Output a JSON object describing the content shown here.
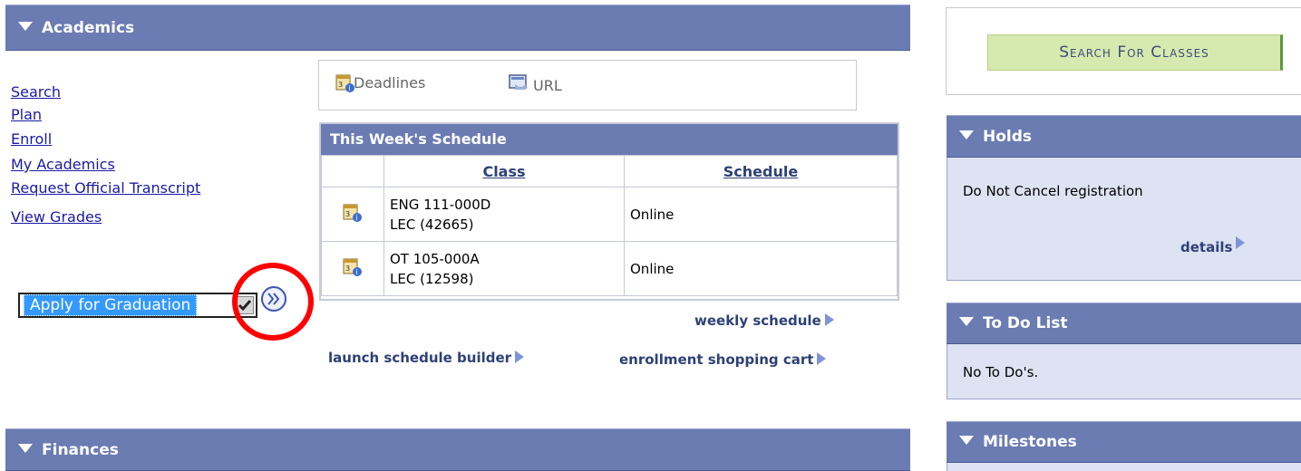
{
  "academics": {
    "title": "Academics",
    "nav_links": [
      "Search",
      "Plan",
      "Enroll",
      "My Academics",
      "Request Official Transcript",
      "View Grades"
    ],
    "dropdown_value": "Apply for Graduation",
    "toolbar": {
      "deadlines": "Deadlines",
      "url": "URL"
    },
    "schedule": {
      "title": "This Week's Schedule",
      "col_class": "Class",
      "col_schedule": "Schedule",
      "rows": [
        {
          "class_line1": "ENG 111-000D",
          "class_line2": "LEC (42665)",
          "schedule": "Online"
        },
        {
          "class_line1": "OT 105-000A",
          "class_line2": "LEC (12598)",
          "schedule": "Online"
        }
      ]
    },
    "weekly_schedule_link": "weekly schedule",
    "launch_schedule_builder_link": "launch schedule builder",
    "shopping_cart_link": "enrollment shopping cart"
  },
  "finances": {
    "title": "Finances"
  },
  "sidebar": {
    "search_button": "Search For Classes",
    "holds": {
      "title": "Holds",
      "text": "Do Not Cancel registration",
      "details_link": "details"
    },
    "todo": {
      "title": "To Do List",
      "text": "No To Do's."
    },
    "milestones": {
      "title": "Milestones"
    }
  },
  "colors": {
    "header_bg": "#6b7cb3",
    "pane_bg": "#dde3f2",
    "button_bg": "#d6eab0",
    "highlight_circle": "#ff0000",
    "dropdown_selected": "#3399ff"
  }
}
